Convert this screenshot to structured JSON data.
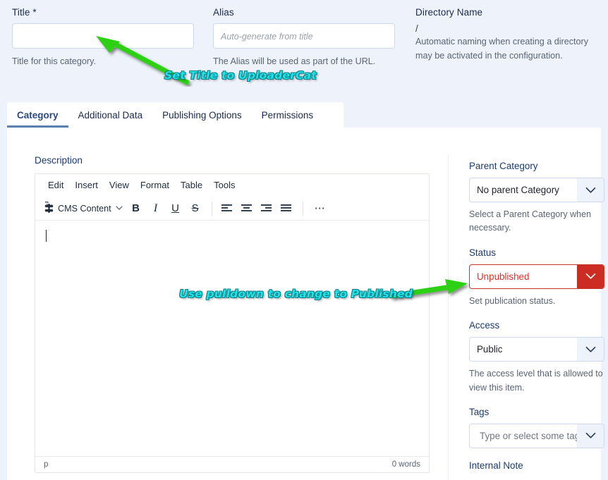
{
  "form": {
    "title": {
      "label": "Title *",
      "value": "",
      "placeholder": "",
      "help": "Title for this category."
    },
    "alias": {
      "label": "Alias",
      "value": "",
      "placeholder": "Auto-generate from title",
      "help": "The Alias will be used as part of the URL."
    },
    "directory": {
      "label": "Directory Name",
      "value": "/",
      "help": "Automatic naming when creating a directory may be activated in the configuration."
    }
  },
  "tabs": [
    {
      "label": "Category",
      "active": true
    },
    {
      "label": "Additional Data",
      "active": false
    },
    {
      "label": "Publishing Options",
      "active": false
    },
    {
      "label": "Permissions",
      "active": false
    }
  ],
  "editor": {
    "label": "Description",
    "menubar": [
      "Edit",
      "Insert",
      "View",
      "Format",
      "Table",
      "Tools"
    ],
    "cms_button": "CMS Content",
    "format_buttons": [
      "B",
      "I",
      "U",
      "S"
    ],
    "align_buttons": [
      "align-left",
      "align-center",
      "align-right",
      "align-justify"
    ],
    "more_button": "…",
    "content": "",
    "status_path": "p",
    "status_words": "0 words"
  },
  "sidebar": {
    "parent_category": {
      "label": "Parent Category",
      "value": "No parent Category",
      "help": "Select a Parent Category when necessary."
    },
    "status": {
      "label": "Status",
      "value": "Unpublished",
      "help": "Set publication status.",
      "accent": "#cb2d23"
    },
    "access": {
      "label": "Access",
      "value": "Public",
      "help": "The access level that is allowed to view this item."
    },
    "tags": {
      "label": "Tags",
      "value": "",
      "placeholder": "Type or select some tags"
    },
    "internal_note": {
      "label": "Internal Note"
    }
  },
  "annotations": [
    {
      "text": "Set Title to UploaderCat",
      "color": "#1ee3e8"
    },
    {
      "text": "Use pulldown to change to Published",
      "color": "#1ee3e8"
    }
  ],
  "colors": {
    "page_background": "#eef2fa",
    "card_background": "#ffffff",
    "label_blue": "#1b3a6b",
    "danger_red": "#cb2d23",
    "arrow_green": "#2fd015",
    "annotation_cyan": "#1ee3e8"
  }
}
